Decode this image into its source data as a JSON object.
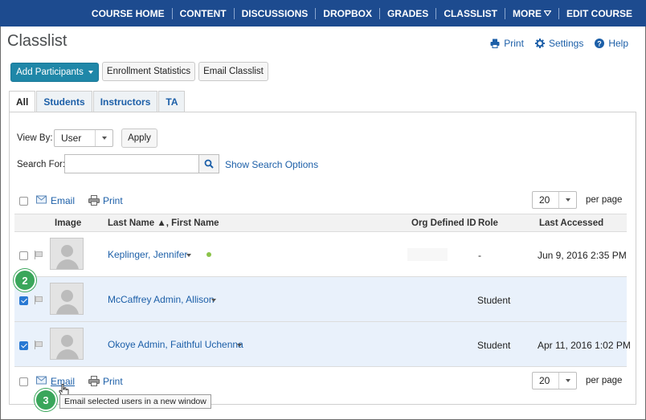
{
  "nav": {
    "items": [
      "COURSE HOME",
      "CONTENT",
      "DISCUSSIONS",
      "DROPBOX",
      "GRADES",
      "CLASSLIST",
      "MORE",
      "EDIT COURSE"
    ]
  },
  "page": {
    "title": "Classlist",
    "print_label": "Print",
    "settings_label": "Settings",
    "help_label": "Help"
  },
  "toolbar": {
    "add_participants": "Add Participants",
    "enrollment_statistics": "Enrollment Statistics",
    "email_classlist": "Email Classlist"
  },
  "tabs": [
    "All",
    "Students",
    "Instructors",
    "TA"
  ],
  "filters": {
    "view_by_label": "View By:",
    "view_by_value": "User",
    "apply_label": "Apply",
    "search_for_label": "Search For:",
    "search_value": "",
    "show_search_options": "Show Search Options"
  },
  "list_actions": {
    "email": "Email",
    "print": "Print",
    "per_page_value": "20",
    "per_page_label": "per page"
  },
  "table": {
    "headers": {
      "image": "Image",
      "name": "Last Name ▲, First Name",
      "org_id": "Org Defined ID",
      "role": "Role",
      "last_accessed": "Last Accessed"
    },
    "rows": [
      {
        "name": "Keplinger, Jennifer",
        "org_id": "",
        "role": "-",
        "last_accessed": "Jun 9, 2016 2:35 PM",
        "selected": false,
        "online": true
      },
      {
        "name": "McCaffrey Admin, Allison",
        "org_id": "",
        "role": "Student",
        "last_accessed": "",
        "selected": true,
        "online": false
      },
      {
        "name": "Okoye Admin, Faithful Uchenna",
        "org_id": "",
        "role": "Student",
        "last_accessed": "Apr 11, 2016 1:02 PM",
        "selected": true,
        "online": false
      }
    ]
  },
  "annotations": {
    "step2": "2",
    "step3": "3",
    "tooltip": "Email selected users in a new window"
  },
  "colors": {
    "nav_bg": "#1d4b8f",
    "primary_button": "#1f87a8",
    "link": "#1c5fa8",
    "selected_row": "#e9f1fb",
    "step_badge": "#3aa65b"
  }
}
